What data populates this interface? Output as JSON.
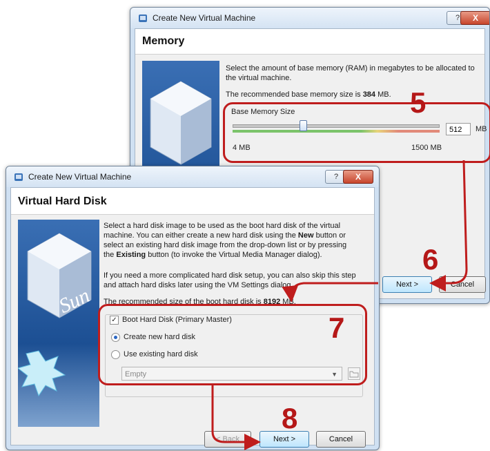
{
  "memory_dialog": {
    "title": "Create New Virtual Machine",
    "help_label": "?",
    "close_label": "X",
    "heading": "Memory",
    "description": "Select the amount of base memory (RAM) in megabytes to be allocated to the virtual machine.",
    "recommended_prefix": "The recommended base memory size is ",
    "recommended_value": "384",
    "recommended_suffix": " MB.",
    "base_memory_label": "Base Memory Size",
    "slider_value": "512",
    "slider_fraction": 0.34,
    "unit": "MB",
    "min_label": "4 MB",
    "max_label": "1500 MB",
    "next_label": "Next >",
    "cancel_label": "Cancel"
  },
  "hdd_dialog": {
    "title": "Create New Virtual Machine",
    "help_label": "?",
    "close_label": "X",
    "heading": "Virtual Hard Disk",
    "desc1_a": "Select a hard disk image to be used as the boot hard disk of the virtual machine. You can either create a new hard disk using the ",
    "desc1_new": "New",
    "desc1_b": " button or select an existing hard disk image from the drop-down list or by pressing the ",
    "desc1_existing": "Existing",
    "desc1_c": " button (to invoke the Virtual Media Manager dialog).",
    "desc2": "If you need a more complicated hard disk setup, you can also skip this step and attach hard disks later using the VM Settings dialog.",
    "recommended_prefix": "The recommended size of the boot hard disk is ",
    "recommended_value": "8192",
    "recommended_suffix": " MB.",
    "boot_checkbox_label": "Boot Hard Disk (Primary Master)",
    "boot_checked": true,
    "radio_create_label": "Create new hard disk",
    "radio_existing_label": "Use existing hard disk",
    "selected_disk": "Empty",
    "back_label": "< Back",
    "next_label": "Next >",
    "cancel_label": "Cancel"
  },
  "annotations": {
    "step5": "5",
    "step6": "6",
    "step7": "7",
    "step8": "8"
  },
  "colors": {
    "annotation_red": "#bf1d1d",
    "slider_green": "#7bc36a",
    "slider_red": "#e28a7a"
  },
  "icons": [
    "virtualbox-icon",
    "help-icon",
    "close-icon",
    "dropdown-arrow-icon",
    "folder-icon",
    "sun-logo-graphic"
  ]
}
